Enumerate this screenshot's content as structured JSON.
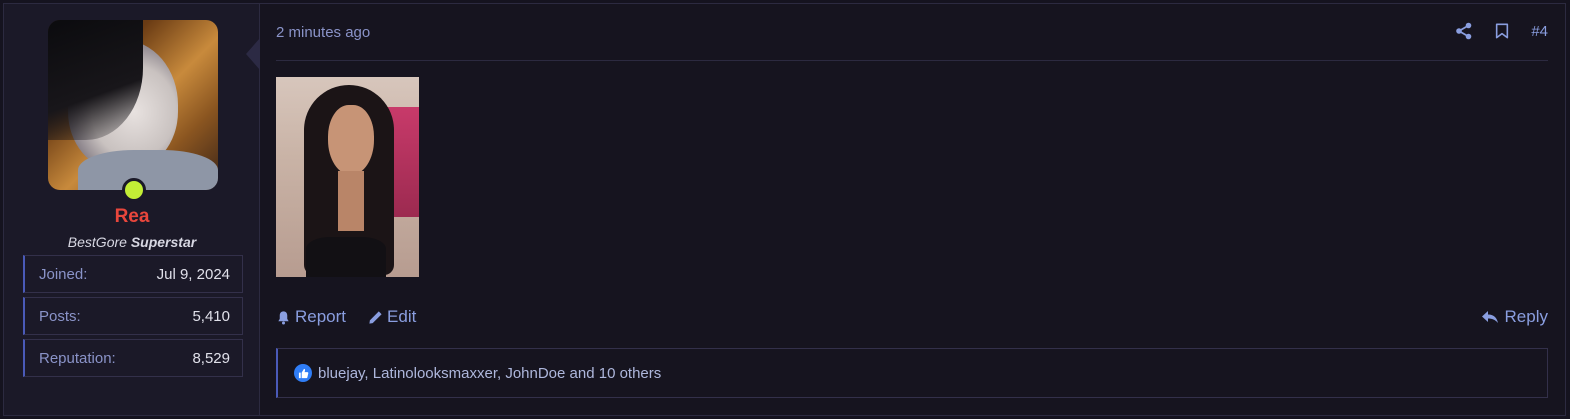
{
  "user": {
    "name": "Rea",
    "title_site": "BestGore",
    "title_rank": "Superstar",
    "online_color": "#c3ee36",
    "stats": [
      {
        "label": "Joined:",
        "value": "Jul 9, 2024"
      },
      {
        "label": "Posts:",
        "value": "5,410"
      },
      {
        "label": "Reputation:",
        "value": "8,529"
      }
    ]
  },
  "post": {
    "timestamp": "2 minutes ago",
    "number": "#4",
    "actions": {
      "report": "Report",
      "edit": "Edit",
      "reply": "Reply"
    },
    "reactions": {
      "text": "bluejay, Latinolooksmaxxer, JohnDoe and 10 others",
      "icon": "thumbs-up-icon"
    }
  },
  "colors": {
    "accent": "#8a9ee0",
    "username": "#e8463c",
    "background": "#15131f"
  }
}
